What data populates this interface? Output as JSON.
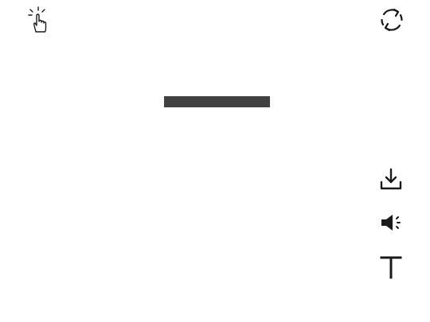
{
  "icons": {
    "tap_hint": "tap-hand-icon",
    "rotate": "rotate-icon",
    "download": "download-icon",
    "audio": "speaker-icon",
    "text": "text-icon"
  },
  "colors": {
    "icon": "#1a1a1a",
    "bar": "#414141",
    "background": "#ffffff"
  }
}
